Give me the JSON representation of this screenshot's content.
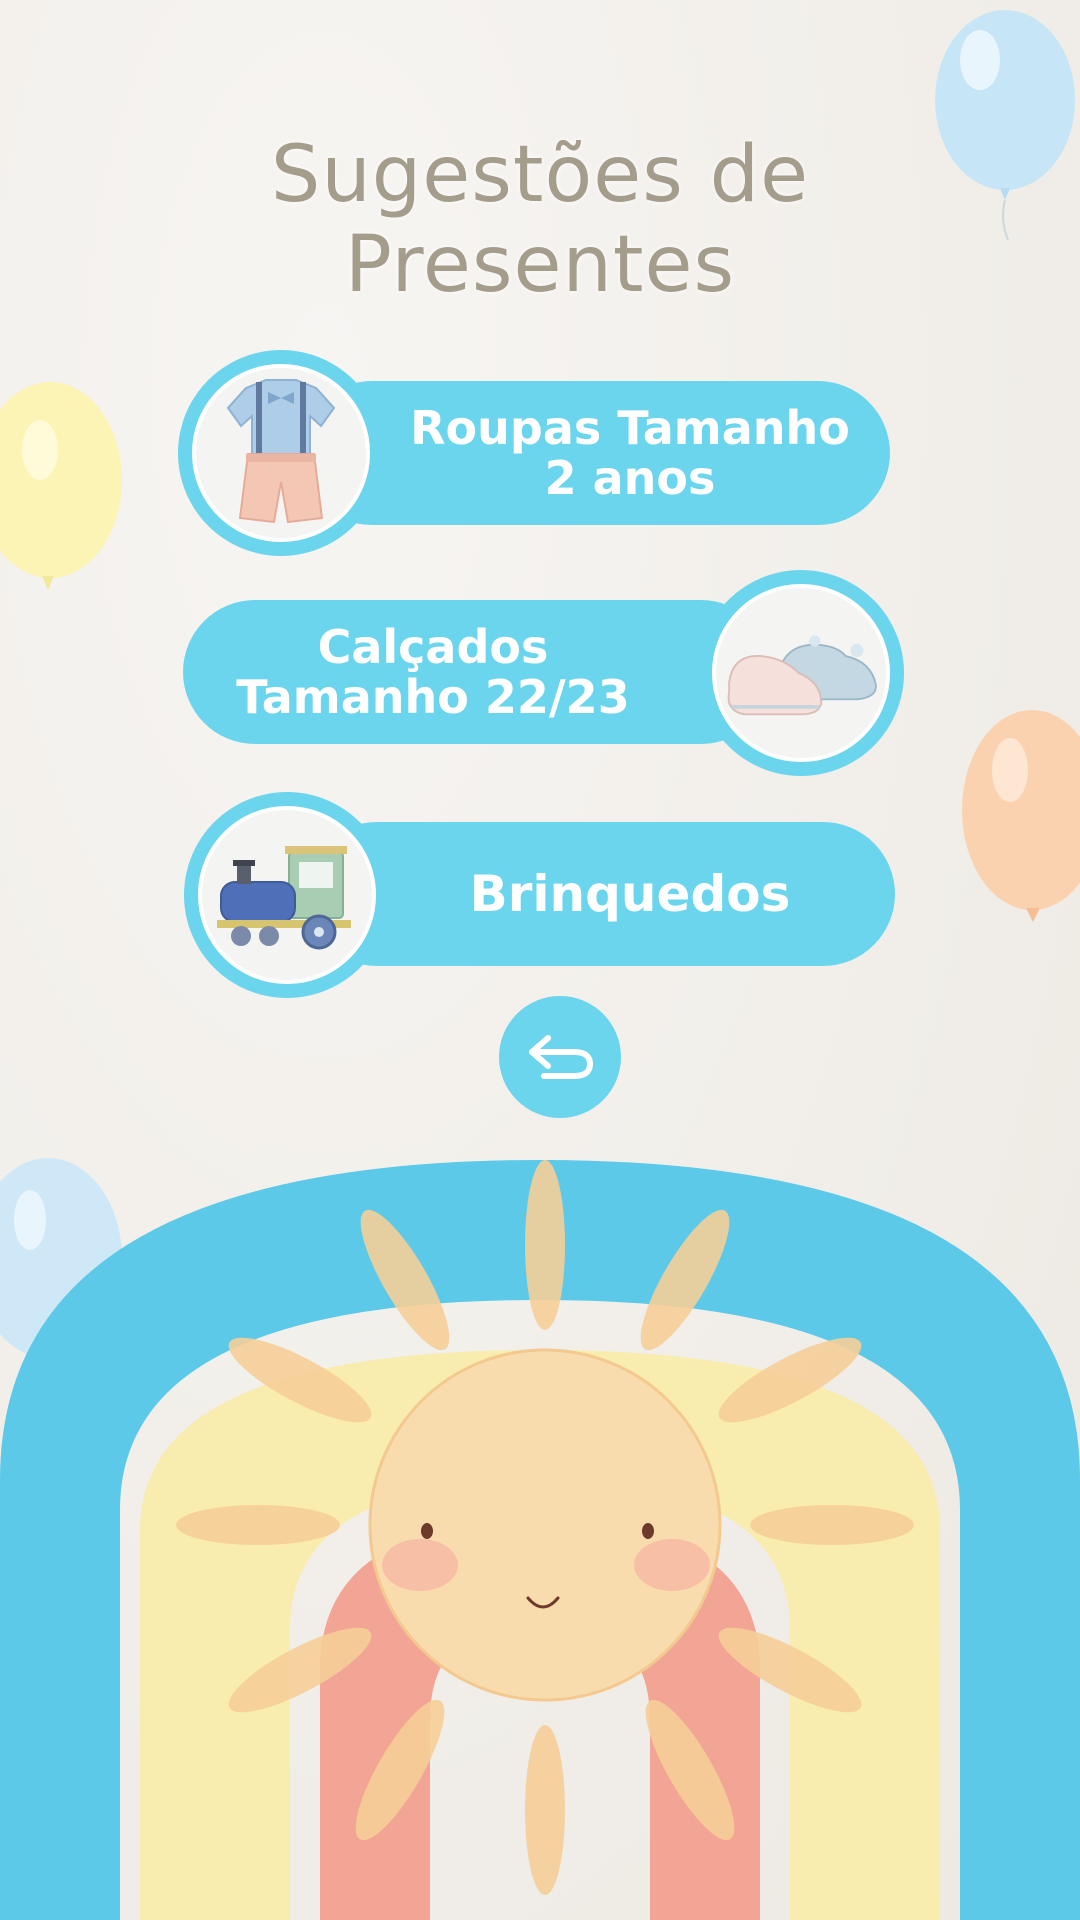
{
  "title": {
    "line1": "Sugestões de",
    "line2": "Presentes"
  },
  "options": [
    {
      "label_line1": "Roupas Tamanho",
      "label_line2": "2 anos",
      "icon": "outfit-icon"
    },
    {
      "label_line1": "Calçados",
      "label_line2": "Tamanho 22/23",
      "icon": "baby-shoes-icon"
    },
    {
      "label_line1": "Brinquedos",
      "label_line2": "",
      "icon": "toy-train-icon"
    }
  ],
  "back_button": {
    "icon": "return-arrow-icon"
  },
  "colors": {
    "accent": "#6bd5ee",
    "title": "#a59d8c",
    "rainbow_blue": "#5cc9e8",
    "rainbow_yellow": "#f8ecae",
    "rainbow_pink": "#f2a595",
    "sun": "#f8d9a6"
  }
}
